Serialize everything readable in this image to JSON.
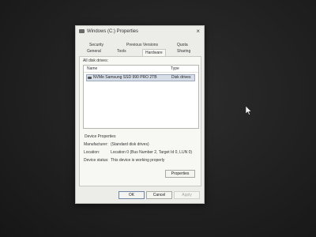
{
  "window": {
    "title": "Windows (C:) Properties",
    "close_glyph": "×"
  },
  "tabs": {
    "row1": [
      "Security",
      "Previous Versions",
      "Quota"
    ],
    "row2": [
      "General",
      "Tools",
      "Hardware",
      "Sharing"
    ],
    "active": "Hardware"
  },
  "hardware": {
    "list_label": "All disk drives:",
    "columns": {
      "name": "Name",
      "type": "Type"
    },
    "rows": [
      {
        "name": "NVMe Samsung SSD 990 PRO 2TB",
        "type": "Disk drives",
        "selected": true
      }
    ]
  },
  "device_properties": {
    "title": "Device Properties",
    "manufacturer_label": "Manufacturer:",
    "manufacturer_value": "(Standard disk drives)",
    "location_label": "Location:",
    "location_value": "Location 0 (Bus Number 2, Target Id 0, LUN 0)",
    "status_label": "Device status:",
    "status_value": "This device is working properly",
    "properties_button": "Properties"
  },
  "footer": {
    "ok_label": "OK",
    "cancel_label": "Cancel",
    "apply_label": "Apply"
  },
  "colors": {
    "dialog_bg": "#ecece8",
    "selection_bg": "#d7dee8",
    "desktop_bg": "#232323"
  }
}
